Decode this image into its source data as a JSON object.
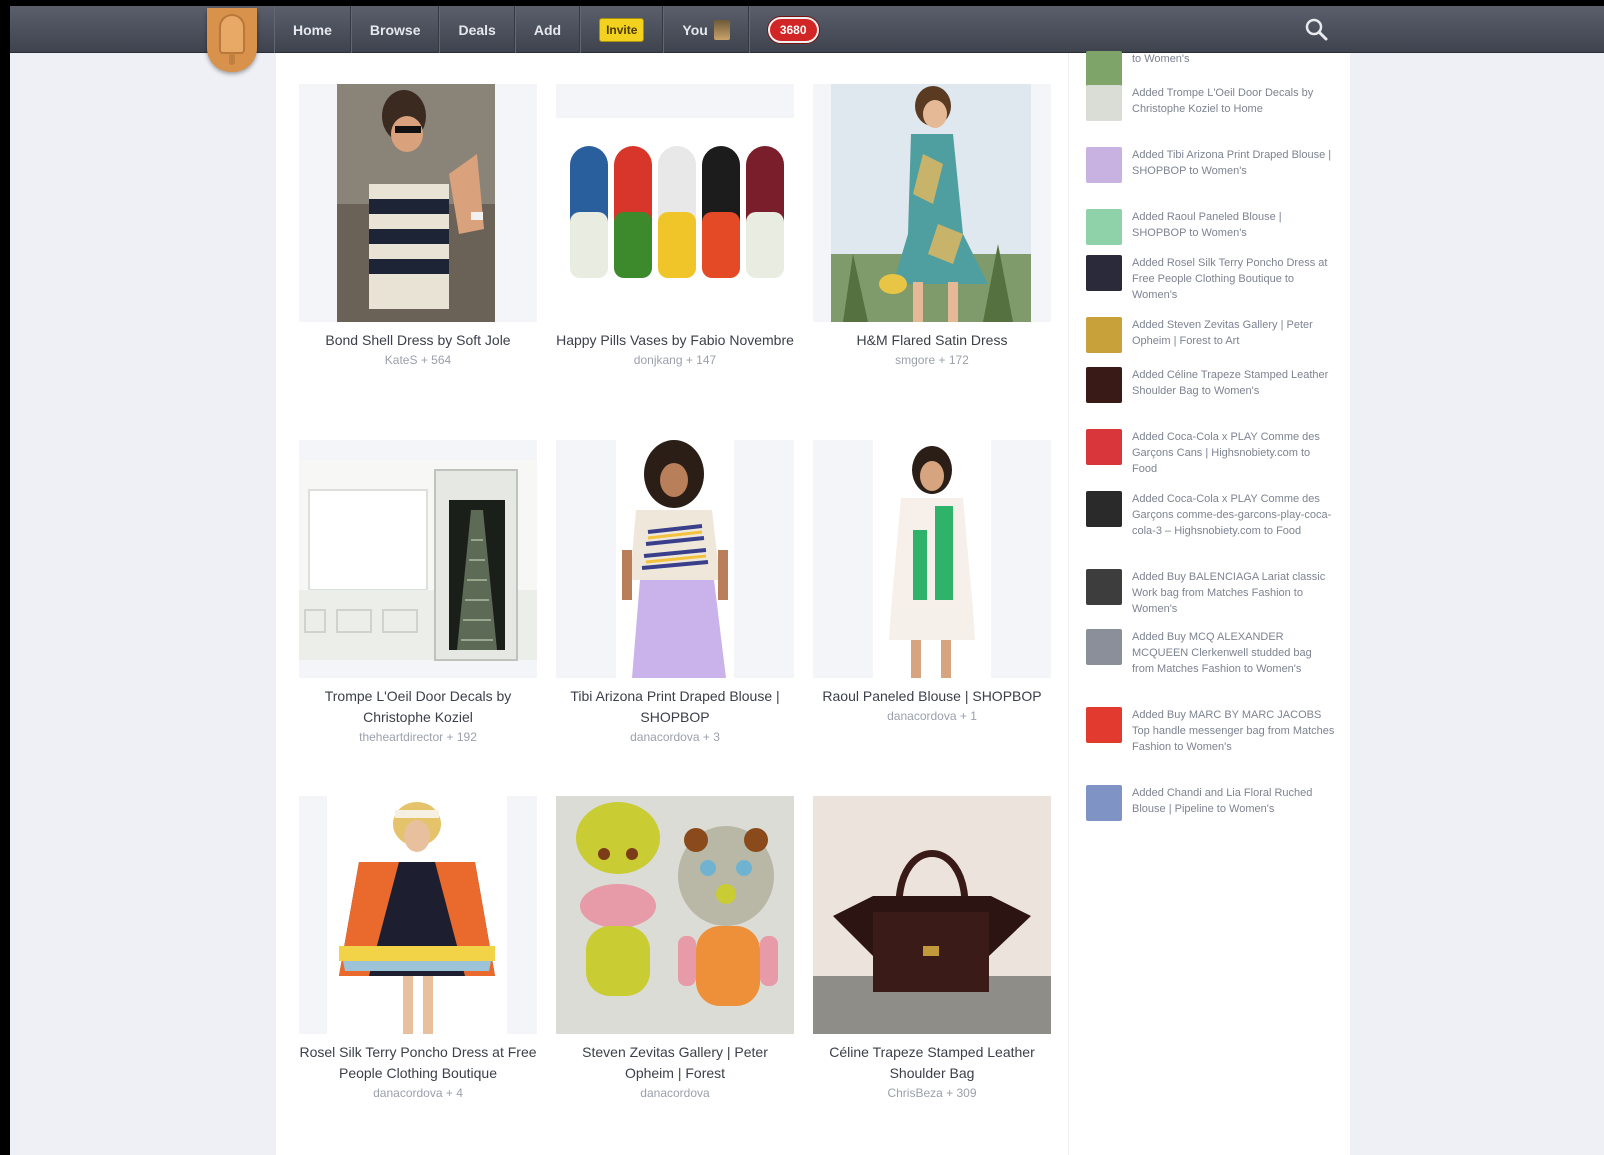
{
  "nav": {
    "items": [
      "Home",
      "Browse",
      "Deals",
      "Add"
    ],
    "invite_label": "Invite",
    "you_label": "You",
    "notification_count": "3680"
  },
  "cards": [
    {
      "title": "Bond Shell Dress by Soft Jole",
      "meta": "KateS + 564"
    },
    {
      "title": "Happy Pills Vases by Fabio Novembre",
      "meta": "donjkang + 147"
    },
    {
      "title": "H&M Flared Satin Dress",
      "meta": "smgore + 172"
    },
    {
      "title": "Trompe L'Oeil Door Decals by Christophe Koziel",
      "meta": "theheartdirector + 192"
    },
    {
      "title": "Tibi Arizona Print Draped Blouse | SHOPBOP",
      "meta": "danacordova + 3"
    },
    {
      "title": "Raoul Paneled Blouse | SHOPBOP",
      "meta": "danacordova + 1"
    },
    {
      "title": "Rosel Silk Terry Poncho Dress at Free People Clothing Boutique",
      "meta": "danacordova + 4"
    },
    {
      "title": "Steven Zevitas Gallery | Peter Opheim | Forest",
      "meta": "danacordova"
    },
    {
      "title": "Céline Trapeze Stamped Leather Shoulder Bag",
      "meta": "ChrisBeza + 309"
    }
  ],
  "activity": [
    {
      "text": "to Women's"
    },
    {
      "text": "Added Trompe L'Oeil Door Decals by Christophe Koziel to Home"
    },
    {
      "text": "Added Tibi Arizona Print Draped Blouse | SHOPBOP to Women's"
    },
    {
      "text": "Added Raoul Paneled Blouse | SHOPBOP to Women's"
    },
    {
      "text": "Added Rosel Silk Terry Poncho Dress at Free People Clothing Boutique to Women's"
    },
    {
      "text": "Added Steven Zevitas Gallery | Peter Opheim | Forest to Art"
    },
    {
      "text": "Added Céline Trapeze Stamped Leather Shoulder Bag to Women's"
    },
    {
      "text": "Added Coca-Cola x PLAY Comme des Garçons Cans | Highsnobiety.com to Food"
    },
    {
      "text": "Added Coca-Cola x PLAY Comme des Garçons comme-des-garcons-play-coca-cola-3 – Highsnobiety.com to Food"
    },
    {
      "text": "Added Buy BALENCIAGA Lariat classic Work bag from Matches Fashion to Women's"
    },
    {
      "text": "Added Buy MCQ ALEXANDER MCQUEEN Clerkenwell studded bag from Matches Fashion to Women's"
    },
    {
      "text": "Added Buy MARC BY MARC JACOBS Top handle messenger bag from Matches Fashion to Women's"
    },
    {
      "text": "Added Chandi and Lia Floral Ruched Blouse | Pipeline to Women's"
    }
  ]
}
